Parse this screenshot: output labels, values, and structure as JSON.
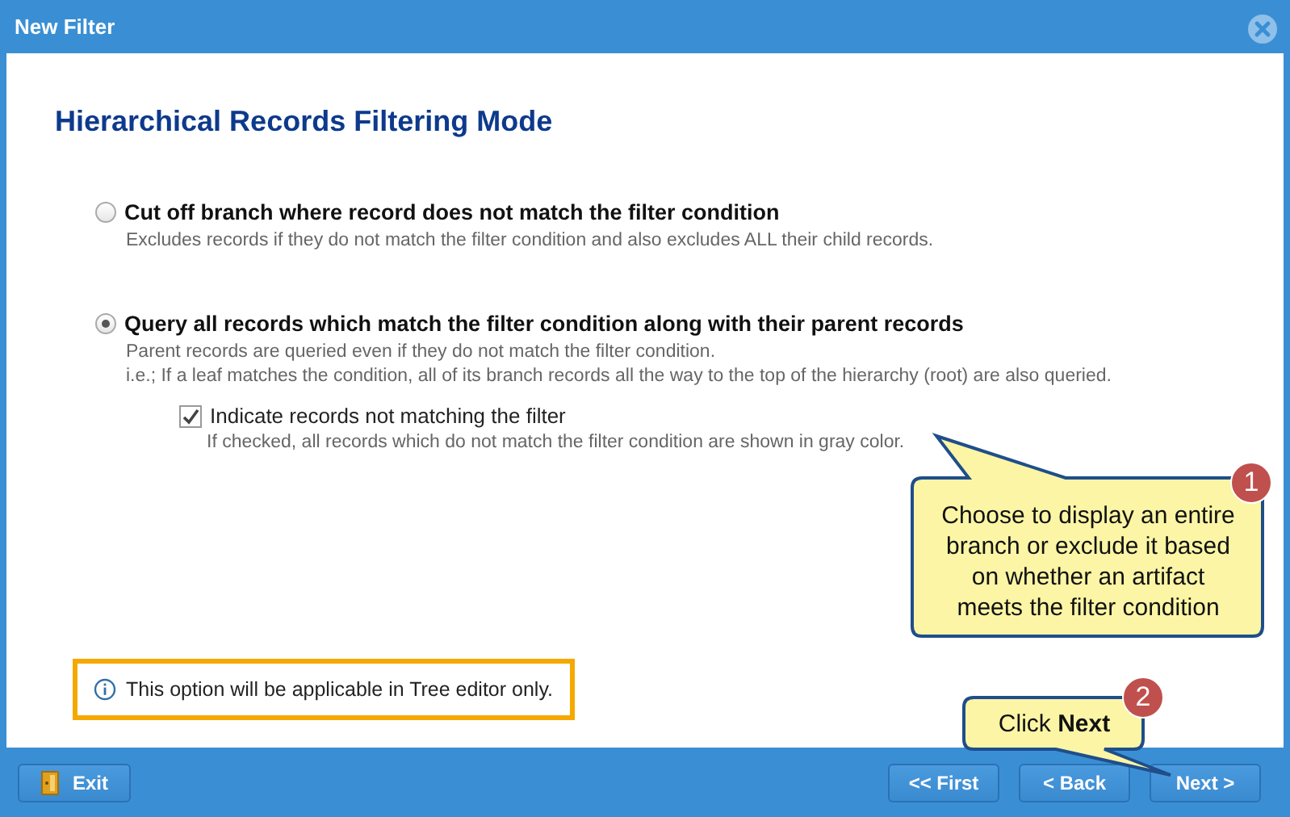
{
  "window": {
    "title": "New Filter"
  },
  "heading": "Hierarchical Records Filtering Mode",
  "options": [
    {
      "label": "Cut off branch where record does not match the filter condition",
      "selected": false,
      "description": [
        "Excludes records if they do not match the filter condition and also excludes ALL their child records."
      ]
    },
    {
      "label": "Query all records which match the filter condition along with their parent records",
      "selected": true,
      "description": [
        "Parent records are queried even if they do not match the filter condition.",
        "i.e.; If a leaf matches the condition, all of its branch records all the way to the top of the hierarchy (root) are also queried."
      ],
      "sub_option": {
        "label": "Indicate records not matching the filter",
        "checked": true,
        "description": "If checked, all records which do not match the filter condition are shown in gray color."
      }
    }
  ],
  "note": "This option will be applicable in Tree editor only.",
  "buttons": [
    {
      "label": "Exit",
      "kind": "exit"
    },
    {
      "label": "<< First",
      "kind": "nav"
    },
    {
      "label": "< Back",
      "kind": "nav"
    },
    {
      "label": "Next >",
      "kind": "nav"
    }
  ],
  "callouts": [
    {
      "number": "1",
      "text": "Choose to display an entire branch or exclude it based on whether an artifact meets the filter condition"
    },
    {
      "number": "2",
      "text": "Click **Next**"
    }
  ]
}
